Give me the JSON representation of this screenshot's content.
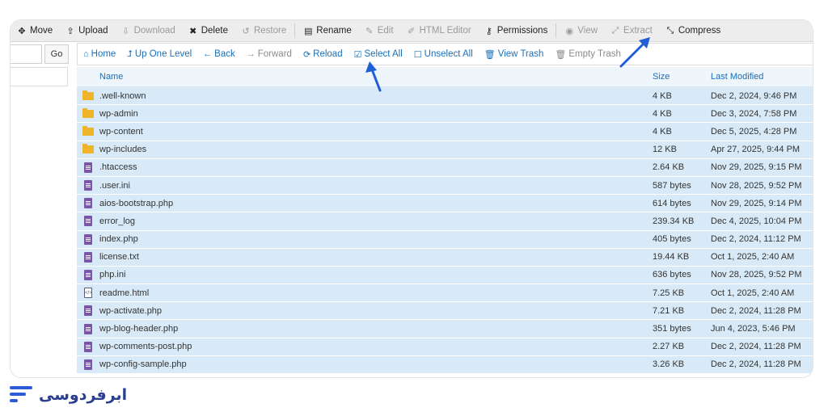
{
  "toolbar": {
    "items": [
      {
        "label": "Move",
        "icon": "move-icon",
        "glyph": "✥",
        "disabled": false
      },
      {
        "label": "Upload",
        "icon": "upload-icon",
        "glyph": "⇪",
        "disabled": false
      },
      {
        "label": "Download",
        "icon": "download-icon",
        "glyph": "⇩",
        "disabled": true
      },
      {
        "label": "Delete",
        "icon": "delete-icon",
        "glyph": "✖",
        "disabled": false
      },
      {
        "label": "Restore",
        "icon": "restore-icon",
        "glyph": "↺",
        "disabled": true
      },
      {
        "label": "Rename",
        "icon": "rename-icon",
        "glyph": "▤",
        "disabled": false
      },
      {
        "label": "Edit",
        "icon": "edit-icon",
        "glyph": "✎",
        "disabled": true
      },
      {
        "label": "HTML Editor",
        "icon": "html-editor-icon",
        "glyph": "✐",
        "disabled": true
      },
      {
        "label": "Permissions",
        "icon": "key-icon",
        "glyph": "⚷",
        "disabled": false
      },
      {
        "label": "View",
        "icon": "eye-icon",
        "glyph": "◉",
        "disabled": true
      },
      {
        "label": "Extract",
        "icon": "extract-icon",
        "glyph": "⤢",
        "disabled": true
      },
      {
        "label": "Compress",
        "icon": "compress-icon",
        "glyph": "⤡",
        "disabled": false
      }
    ]
  },
  "left": {
    "go_label": "Go"
  },
  "nav": {
    "items": [
      {
        "label": "Home",
        "icon": "home-icon",
        "glyph": "⌂",
        "disabled": false
      },
      {
        "label": "Up One Level",
        "icon": "level-up-icon",
        "glyph": "⮥",
        "disabled": false
      },
      {
        "label": "Back",
        "icon": "back-arrow-icon",
        "glyph": "←",
        "disabled": false
      },
      {
        "label": "Forward",
        "icon": "forward-arrow-icon",
        "glyph": "→",
        "disabled": true
      },
      {
        "label": "Reload",
        "icon": "reload-icon",
        "glyph": "⟳",
        "disabled": false
      },
      {
        "label": "Select All",
        "icon": "checkbox-checked-icon",
        "glyph": "☑",
        "disabled": false
      },
      {
        "label": "Unselect All",
        "icon": "checkbox-empty-icon",
        "glyph": "☐",
        "disabled": false
      },
      {
        "label": "View Trash",
        "icon": "trash-icon",
        "glyph": "🗑",
        "disabled": false
      },
      {
        "label": "Empty Trash",
        "icon": "empty-trash-icon",
        "glyph": "🗑",
        "disabled": true
      }
    ]
  },
  "table": {
    "headers": {
      "name": "Name",
      "size": "Size",
      "modified": "Last Modified"
    },
    "rows": [
      {
        "type": "folder",
        "name": ".well-known",
        "size": "4 KB",
        "modified": "Dec 2, 2024, 9:46 PM"
      },
      {
        "type": "folder",
        "name": "wp-admin",
        "size": "4 KB",
        "modified": "Dec 3, 2024, 7:58 PM"
      },
      {
        "type": "folder",
        "name": "wp-content",
        "size": "4 KB",
        "modified": "Dec 5, 2025, 4:28 PM"
      },
      {
        "type": "folder",
        "name": "wp-includes",
        "size": "12 KB",
        "modified": "Apr 27, 2025, 9:44 PM"
      },
      {
        "type": "file",
        "name": ".htaccess",
        "size": "2.64 KB",
        "modified": "Nov 29, 2025, 9:15 PM"
      },
      {
        "type": "file",
        "name": ".user.ini",
        "size": "587 bytes",
        "modified": "Nov 28, 2025, 9:52 PM"
      },
      {
        "type": "file",
        "name": "aios-bootstrap.php",
        "size": "614 bytes",
        "modified": "Nov 29, 2025, 9:14 PM"
      },
      {
        "type": "file",
        "name": "error_log",
        "size": "239.34 KB",
        "modified": "Dec 4, 2025, 10:04 PM"
      },
      {
        "type": "file",
        "name": "index.php",
        "size": "405 bytes",
        "modified": "Dec 2, 2024, 11:12 PM"
      },
      {
        "type": "file",
        "name": "license.txt",
        "size": "19.44 KB",
        "modified": "Oct 1, 2025, 2:40 AM"
      },
      {
        "type": "file",
        "name": "php.ini",
        "size": "636 bytes",
        "modified": "Nov 28, 2025, 9:52 PM"
      },
      {
        "type": "html",
        "name": "readme.html",
        "size": "7.25 KB",
        "modified": "Oct 1, 2025, 2:40 AM"
      },
      {
        "type": "file",
        "name": "wp-activate.php",
        "size": "7.21 KB",
        "modified": "Dec 2, 2024, 11:28 PM"
      },
      {
        "type": "file",
        "name": "wp-blog-header.php",
        "size": "351 bytes",
        "modified": "Jun 4, 2023, 5:46 PM"
      },
      {
        "type": "file",
        "name": "wp-comments-post.php",
        "size": "2.27 KB",
        "modified": "Dec 2, 2024, 11:28 PM"
      },
      {
        "type": "file",
        "name": "wp-config-sample.php",
        "size": "3.26 KB",
        "modified": "Dec 2, 2024, 11:28 PM"
      }
    ]
  },
  "brand": {
    "name": "ابرفردوسی"
  },
  "colors": {
    "accent": "#1b6fb8",
    "row_selected": "#d8eaf7",
    "arrow": "#1f5fd6",
    "brand": "#2d5bd6"
  }
}
